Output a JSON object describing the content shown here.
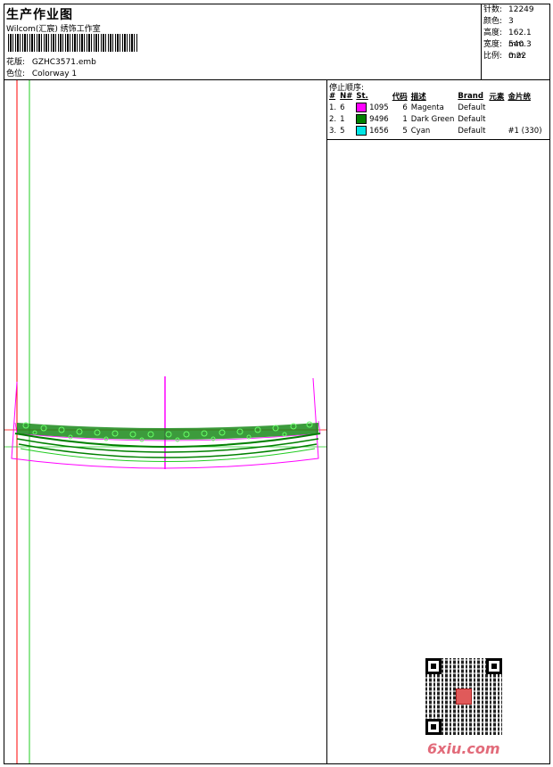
{
  "header": {
    "title": "生产作业图",
    "studio": "Wilcom(汇宸) 绣饰工作室",
    "design_label": "花版:",
    "design_value": "GZHC3571.emb",
    "colorway_label": "色位:",
    "colorway_value": "Colorway 1"
  },
  "stats": [
    {
      "label": "针数:",
      "value": "12249"
    },
    {
      "label": "颜色:",
      "value": "3"
    },
    {
      "label": "高度:",
      "value": "162.1 mm"
    },
    {
      "label": "宽度:",
      "value": "540.3 mm"
    },
    {
      "label": "比例:",
      "value": "0.22"
    }
  ],
  "stop_sequence": {
    "title": "停止顺序:",
    "columns": [
      "#",
      "N#",
      "St.",
      "代码",
      "描述",
      "Brand",
      "元素",
      "金片统"
    ],
    "rows": [
      {
        "idx": "1.",
        "n": "6",
        "color": "#ff00ff",
        "code": "1095",
        "st": "6",
        "desc": "Magenta",
        "brand": "Default",
        "extra": ""
      },
      {
        "idx": "2.",
        "n": "1",
        "color": "#008000",
        "code": "9496",
        "st": "1",
        "desc": "Dark Green",
        "brand": "Default",
        "extra": ""
      },
      {
        "idx": "3.",
        "n": "5",
        "color": "#00e5e5",
        "code": "1656",
        "st": "5",
        "desc": "Cyan",
        "brand": "Default",
        "extra": "#1 (330)"
      }
    ]
  },
  "colors": {
    "magenta": "#ff00ff",
    "green": "#008000",
    "light_green": "#22cc22",
    "red": "#ff0000"
  },
  "watermark": "6xiu.com"
}
